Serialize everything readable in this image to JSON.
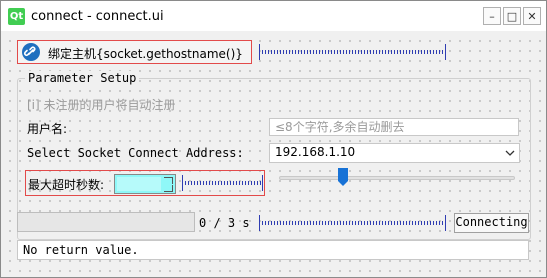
{
  "window": {
    "title": "connect - connect.ui",
    "logo_text": "Qt",
    "minimize": "–",
    "maximize": "□",
    "close": "✕"
  },
  "bind_button": {
    "label": "绑定主机{socket.gethostname()}"
  },
  "group": {
    "title": "Parameter Setup",
    "auto_register_checkbox": "[i] 未注册的用户将自动注册",
    "username_label": "用户名:",
    "username_placeholder": "≤8个字符,多余自动删去",
    "address_label": "Select Socket Connect Address:",
    "address_value": "192.168.1.10",
    "timeout_label": "最大超时秒数:",
    "timeout_slider_level": 0.2
  },
  "progress": {
    "value": 0,
    "text": "0 / 3 s"
  },
  "connect_button": {
    "label": "Connecting"
  },
  "status": {
    "text": "No return value."
  }
}
